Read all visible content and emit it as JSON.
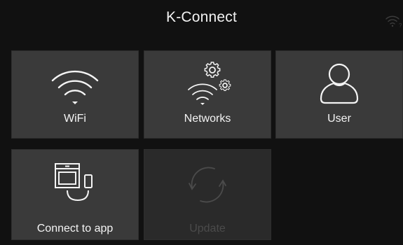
{
  "header": {
    "title": "K-Connect",
    "status_icon": "wifi-question-icon"
  },
  "tiles": [
    {
      "label": "WiFi",
      "icon": "wifi-icon",
      "enabled": true
    },
    {
      "label": "Networks",
      "icon": "wifi-settings-icon",
      "enabled": true
    },
    {
      "label": "User",
      "icon": "user-icon",
      "enabled": true
    },
    {
      "label": "Connect to app",
      "icon": "oven-phone-link-icon",
      "enabled": true
    },
    {
      "label": "Update",
      "icon": "refresh-icon",
      "enabled": false
    }
  ],
  "colors": {
    "background": "#111111",
    "tile": "#3a3a3a",
    "tile_disabled": "#2a2a2a",
    "text": "#f4f4f4",
    "text_disabled": "#4b4b4b"
  }
}
